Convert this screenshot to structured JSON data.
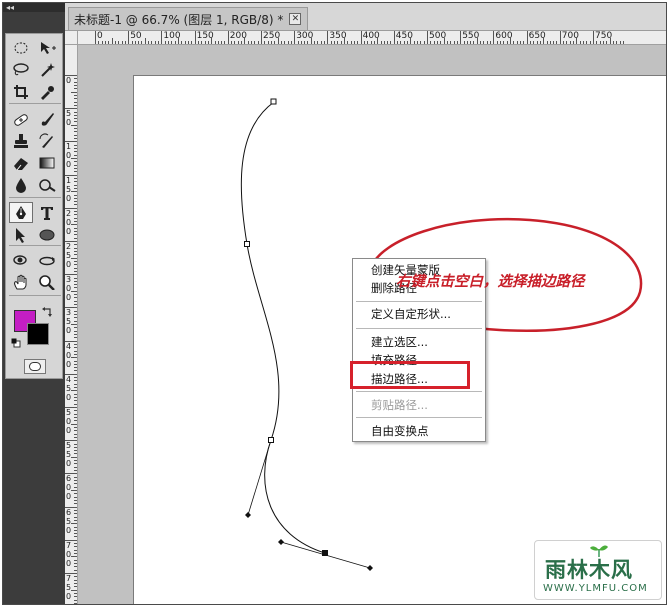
{
  "document_tab": {
    "title": "未标题-1 @ 66.7% (图层 1, RGB/8) *",
    "close_glyph": "✕"
  },
  "toolbox": {
    "collapse_glyph": "◂◂",
    "foreground_color": "#c41ec4",
    "background_color": "#000000",
    "tools": [
      "marquee-tool-icon",
      "move-tool-icon",
      "lasso-tool-icon",
      "magic-wand-tool-icon",
      "crop-tool-icon",
      "eyedropper-tool-icon",
      "healing-brush-icon",
      "brush-tool-icon",
      "clone-stamp-icon",
      "history-brush-icon",
      "eraser-tool-icon",
      "gradient-tool-icon",
      "blur-tool-icon",
      "dodge-tool-icon",
      "pen-tool-icon",
      "type-tool-icon",
      "path-selection-icon",
      "ellipse-tool-icon",
      "3d-rotate-icon",
      "3d-orbit-icon",
      "hand-tool-icon",
      "zoom-tool-icon"
    ],
    "active_tool": "pen-tool-icon"
  },
  "rulers": {
    "horizontal_labels": [
      "0",
      "50",
      "100",
      "150",
      "200",
      "250",
      "300",
      "350",
      "400",
      "450",
      "500",
      "550",
      "600",
      "650",
      "700",
      "750"
    ],
    "vertical_labels": [
      "0",
      "5 0",
      "1 0 0",
      "1 5 0",
      "2 0 0",
      "2 5 0",
      "3 0 0",
      "3 5 0",
      "4 0 0",
      "4 5 0",
      "5 0 0",
      "5 5 0",
      "6 0 0",
      "6 5 0",
      "7 0 0",
      "7 5 0",
      "8 0 0"
    ]
  },
  "context_menu": {
    "items": [
      {
        "label": "创建矢量蒙版",
        "enabled": true
      },
      {
        "label": "删除路径",
        "enabled": true
      },
      {
        "label": "定义自定形状...",
        "enabled": true
      },
      {
        "label": "建立选区...",
        "enabled": true
      },
      {
        "label": "填充路径...",
        "enabled": true
      },
      {
        "label": "描边路径...",
        "enabled": true
      },
      {
        "label": "剪贴路径...",
        "enabled": false
      },
      {
        "label": "自由变换点",
        "enabled": true
      }
    ],
    "highlighted_item": "描边路径..."
  },
  "annotation": {
    "text": "右键点击空白，选择描边路径",
    "color": "#c81e28"
  },
  "watermark": {
    "main": "雨林木风",
    "sub": "WWW.YLMFU.COM",
    "color": "#2a6f49"
  }
}
